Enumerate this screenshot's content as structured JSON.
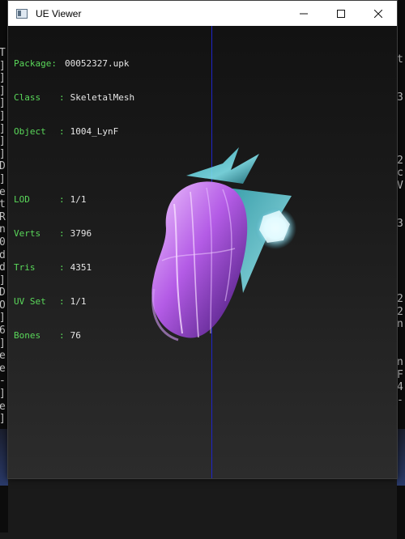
{
  "window": {
    "title": "UE Viewer",
    "minimize_glyph": "minimize",
    "maximize_glyph": "maximize",
    "close_glyph": "close"
  },
  "info": {
    "package": {
      "label": "Package:",
      "value": "00052327.upk"
    },
    "class": {
      "label": "Class",
      "value": "SkeletalMesh"
    },
    "object": {
      "label": "Object",
      "value": "1004_LynF"
    },
    "lod": {
      "label": "LOD",
      "value": "1/1"
    },
    "verts": {
      "label": "Verts",
      "value": "3796"
    },
    "tris": {
      "label": "Tris",
      "value": "4351"
    },
    "uvset": {
      "label": "UV Set",
      "value": "1/1"
    },
    "bones": {
      "label": "Bones",
      "value": "76"
    },
    "separator": ":"
  },
  "background_console": {
    "left_chars": [
      "T",
      "]",
      "]",
      "]",
      "]",
      "]",
      "]",
      "]",
      "]",
      "D",
      "]",
      "e",
      "t",
      "R",
      "n",
      "0",
      "d",
      "d",
      "]",
      "D",
      "O",
      "]",
      "6",
      "]",
      "e",
      "e",
      "-",
      "]",
      "e",
      "]"
    ],
    "right_chars": [
      "t",
      "",
      "",
      "3",
      "",
      "",
      "",
      "",
      "2",
      "c",
      "V",
      "",
      "",
      "3",
      "",
      "",
      "",
      "",
      "",
      "2",
      "2",
      "n",
      "",
      "",
      "n",
      "F",
      "4",
      "-"
    ]
  },
  "colors": {
    "info_label": "#5ad85a",
    "info_value": "#e6e6e6",
    "axis_line": "#1e24c8"
  }
}
